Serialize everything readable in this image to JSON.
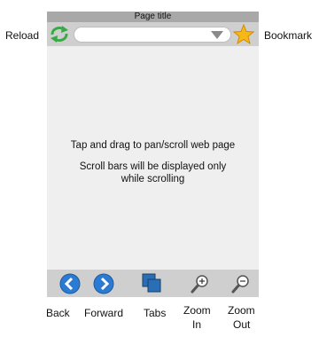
{
  "window": {
    "title": "Page title"
  },
  "address_bar": {
    "url": ""
  },
  "content": {
    "line1": "Tap and drag to pan/scroll web page",
    "line2": "Scroll bars will be displayed only",
    "line3": "while scrolling"
  },
  "callouts": {
    "reload": "Reload",
    "bookmark": "Bookmark",
    "back": "Back",
    "forward": "Forward",
    "tabs": "Tabs",
    "zoom_in_1": "Zoom",
    "zoom_in_2": "In",
    "zoom_out_1": "Zoom",
    "zoom_out_2": "Out"
  },
  "colors": {
    "title_bar": "#a8a8a8",
    "toolbar": "#cfcfcf",
    "content_bg": "#efefef",
    "nav_blue": "#2a7bd1",
    "reload_green": "#3aa845",
    "star": "#f5b816"
  },
  "icons": [
    "reload-icon",
    "dropdown-icon",
    "star-icon",
    "back-icon",
    "forward-icon",
    "tabs-icon",
    "zoom-in-icon",
    "zoom-out-icon"
  ]
}
